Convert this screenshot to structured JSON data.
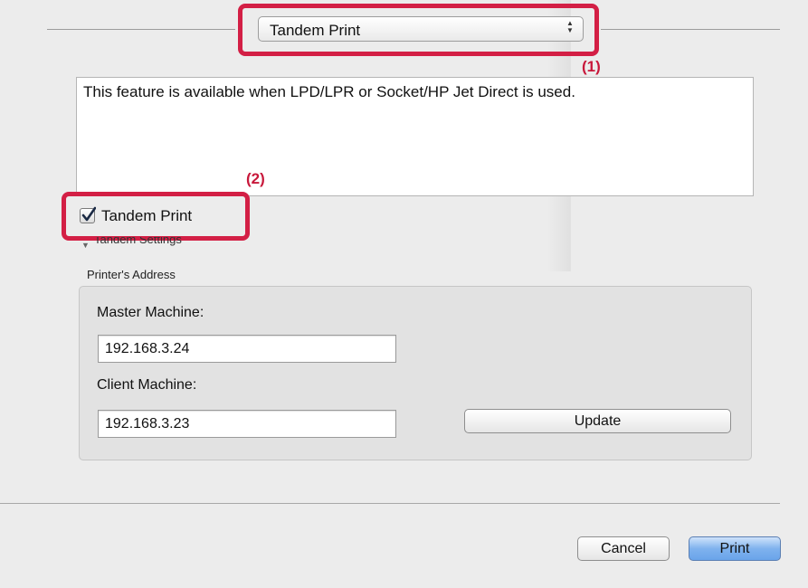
{
  "print_options": {
    "pane_selector": {
      "selected": "Tandem Print",
      "arrows_icon": "up-down-chevron-icon"
    },
    "callouts": {
      "one": "(1)",
      "two": "(2)"
    },
    "description": "This feature is available when LPD/LPR or Socket/HP Jet Direct is used.",
    "tandem_checkbox": {
      "label": "Tandem Print",
      "checked": true
    },
    "tandem_settings_disclosure": "Tandem Settings",
    "printer_address": {
      "title": "Printer's Address",
      "master_label": "Master Machine:",
      "master_value": "192.168.3.24",
      "client_label": "Client Machine:",
      "client_value": "192.168.3.23",
      "update_button": "Update"
    }
  },
  "footer": {
    "cancel_button": "Cancel",
    "print_button": "Print"
  },
  "colors": {
    "callout": "#d31f45",
    "default_button": "#7fb2ee"
  }
}
